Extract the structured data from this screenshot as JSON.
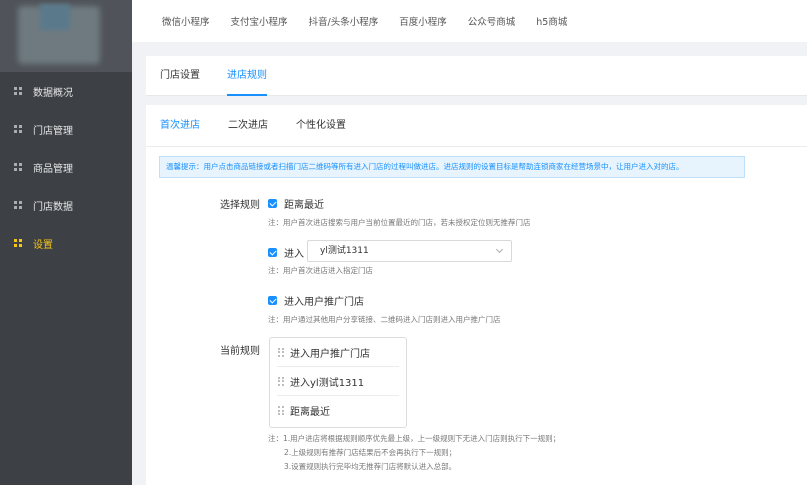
{
  "sidebar": {
    "items": [
      {
        "label": "数据概况",
        "active": false
      },
      {
        "label": "门店管理",
        "active": false
      },
      {
        "label": "商品管理",
        "active": false
      },
      {
        "label": "门店数据",
        "active": false
      },
      {
        "label": "设置",
        "active": true
      }
    ]
  },
  "topbar": {
    "tabs": [
      "微信小程序",
      "支付宝小程序",
      "抖音/头条小程序",
      "百度小程序",
      "公众号商城",
      "h5商城"
    ]
  },
  "subtabs": {
    "items": [
      "门店设置",
      "进店规则"
    ],
    "active": "进店规则"
  },
  "innertabs": {
    "items": [
      "首次进店",
      "二次进店",
      "个性化设置"
    ],
    "active": "首次进店"
  },
  "notice": "温馨提示：用户点击商品链接或者扫描门店二维码等所有进入门店的过程叫做进店。进店规则的设置目标是帮助连锁商家在经营场景中，让用户进入对的店。",
  "rules": {
    "select_label": "选择规则",
    "nearest": {
      "label": "距离最近",
      "checked": true,
      "note": "注：用户首次进店搜索与用户当前位置最近的门店，若未授权定位则无推荐门店"
    },
    "enter": {
      "label": "进入",
      "checked": true,
      "selected_store": "yl测试1311",
      "note": "注：用户首次进店进入指定门店"
    },
    "promoter": {
      "label": "进入用户推广门店",
      "checked": true,
      "note": "注：用户通过其他用户分享链接、二维码进入门店则进入用户推广门店"
    }
  },
  "current_rules": {
    "label": "当前规则",
    "items": [
      "进入用户推广门店",
      "进入yl测试1311",
      "距离最近"
    ]
  },
  "footnotes": [
    "注：1.用户进店将根据规则顺序优先最上级，上一级规则下无进入门店则执行下一规则；",
    "2.上级规则有推荐门店结果后不会再执行下一规则；",
    "3.设置规则执行完毕均无推荐门店将默认进入总部。"
  ],
  "colors": {
    "sidebar_bg": "#3d4045",
    "accent": "#1890ff",
    "active_nav": "#f5c518"
  }
}
